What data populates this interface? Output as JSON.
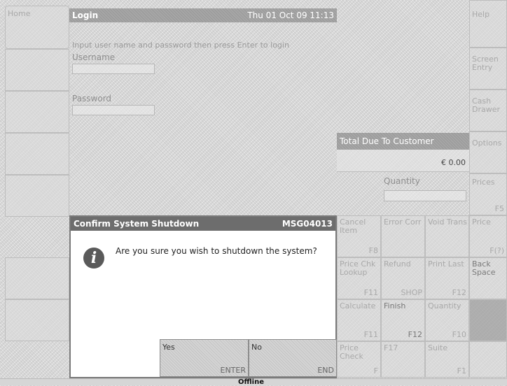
{
  "home": {
    "label": "Home"
  },
  "login": {
    "title": "Login",
    "datetime": "Thu 01 Oct 09  11:13",
    "instruction": "Input user name and password then press Enter to login",
    "username_label": "Username",
    "username_value": "",
    "password_label": "Password",
    "password_value": ""
  },
  "right_panel": {
    "help_label": "Help",
    "screen_entry_label": "Screen Entry",
    "item3_label": "Cash Drawer",
    "item4_label": "Options",
    "total_label": "Total Due To Customer",
    "total_value": "€ 0.00",
    "quantity_label": "Quantity",
    "quantity_value": "",
    "side_label_1": "Prices",
    "side_label_2": "Price",
    "side_key_1": "F5",
    "side_key_2": "F(?)",
    "backspace_label": "Back Space"
  },
  "keypad": {
    "r1": [
      {
        "label": "Cancel Item",
        "key": "F8"
      },
      {
        "label": "Error Corr",
        "key": ""
      },
      {
        "label": "Void Trans",
        "key": ""
      }
    ],
    "r2": [
      {
        "label": "Price Chk Lookup",
        "key": "F11"
      },
      {
        "label": "Refund",
        "key": "SHOP"
      },
      {
        "label": "Print Last",
        "key": "F12"
      }
    ],
    "r3": [
      {
        "label": "Calculate",
        "key": "F11"
      },
      {
        "label": "Finish",
        "key": "F12"
      },
      {
        "label": "Quantity",
        "key": "F10"
      }
    ],
    "r4": [
      {
        "label": "Price Check",
        "key": "F"
      },
      {
        "label": "F17",
        "key": ""
      },
      {
        "label": "Suite",
        "key": "F1"
      }
    ]
  },
  "dialog": {
    "title": "Confirm System Shutdown",
    "code": "MSG04013",
    "message": "Are you sure you wish to shutdown the system?",
    "yes_label": "Yes",
    "yes_key": "ENTER",
    "no_label": "No",
    "no_key": "END"
  },
  "status": {
    "text": "Offline"
  },
  "colors": {
    "dialog_title_bg": "#6d6d6d",
    "header_bg": "#a6a6a6",
    "info_icon_bg": "#5a5a5a"
  }
}
